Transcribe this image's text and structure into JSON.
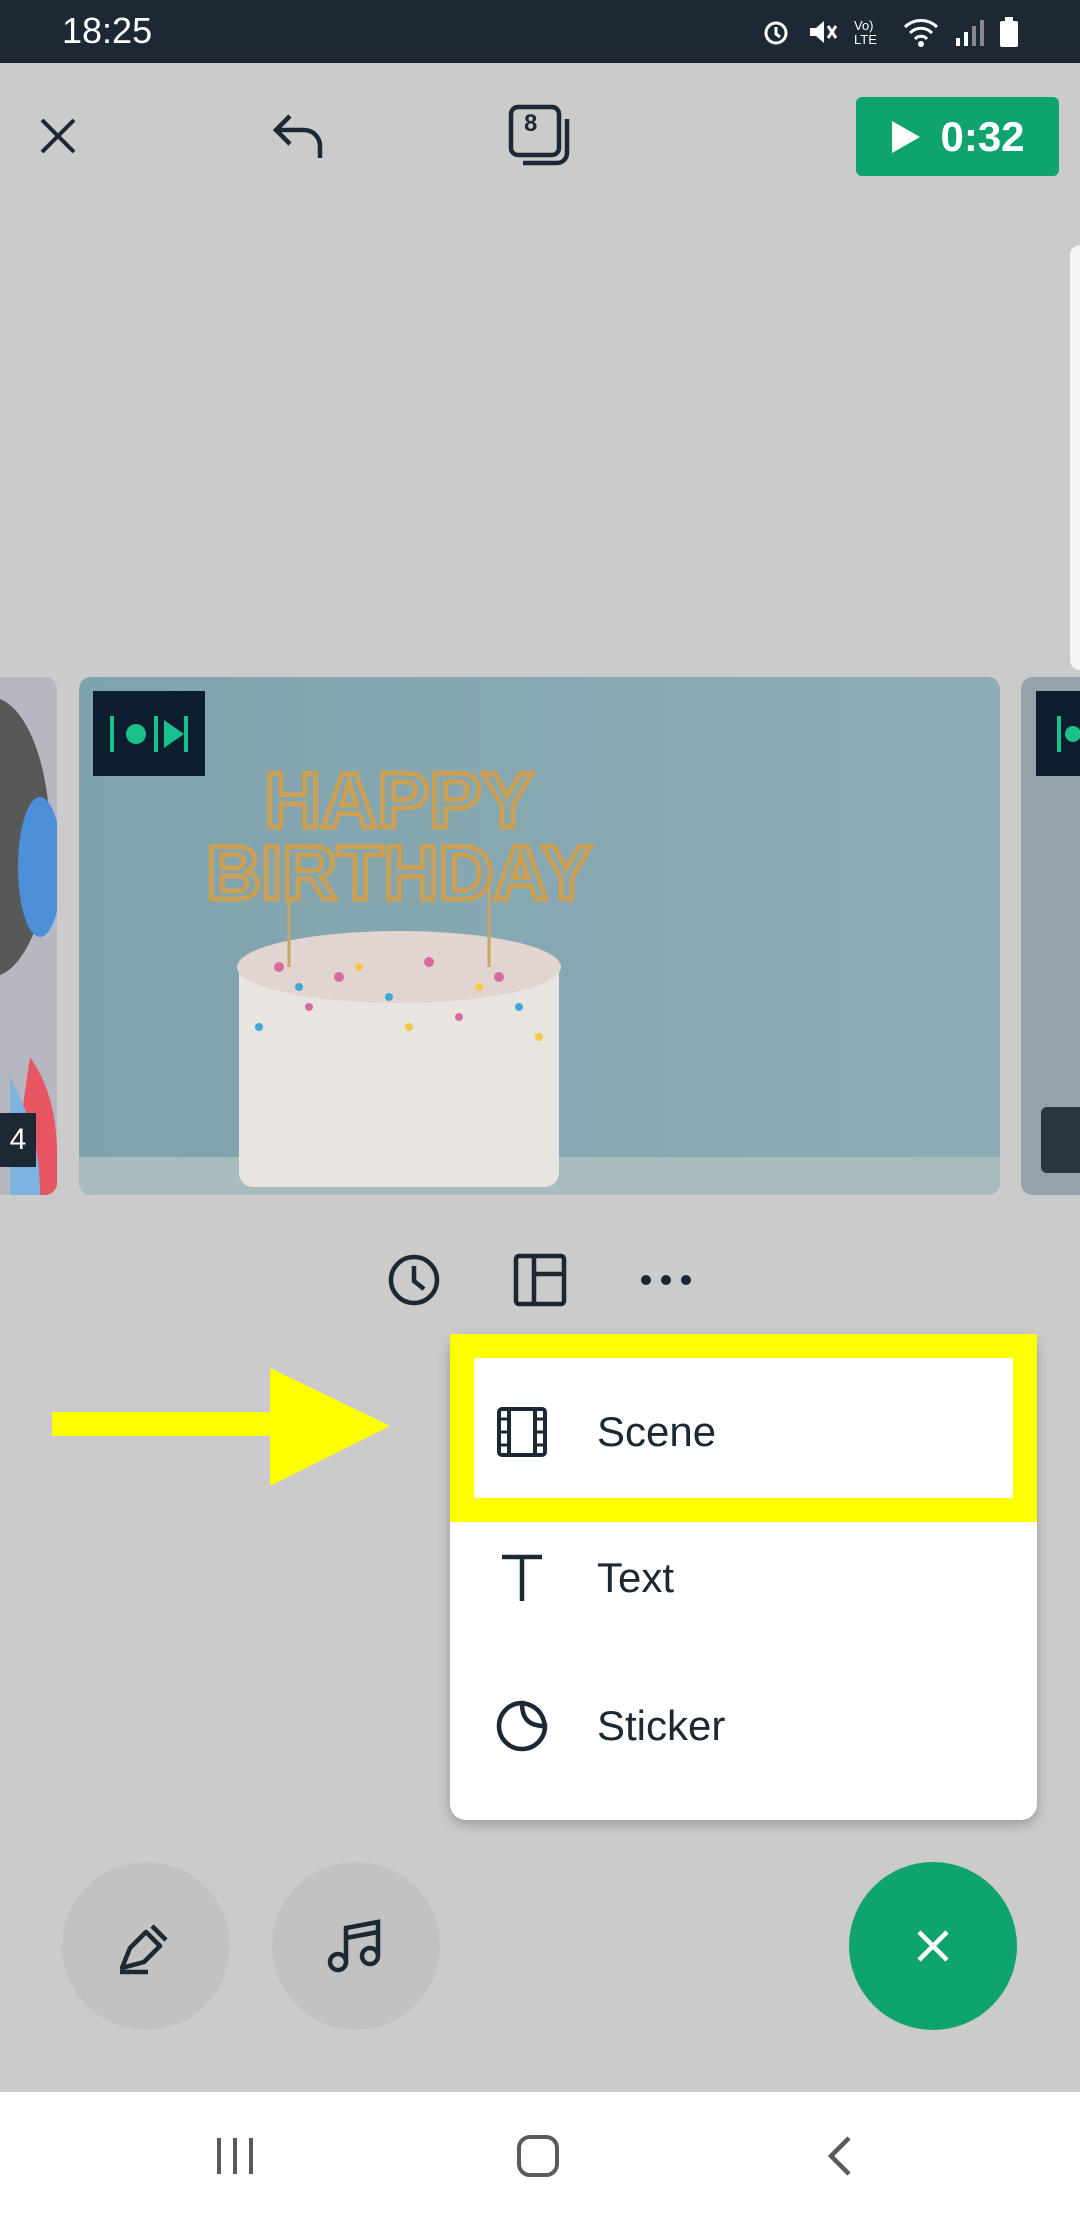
{
  "status": {
    "time": "18:25"
  },
  "toolbar": {
    "close_icon": "close-icon",
    "undo_icon": "undo-icon",
    "scenes_count": "8",
    "play_label": "0:32"
  },
  "scenes": {
    "left_number": "4",
    "center_title": "HAPPY BIRTHDAY"
  },
  "menu": {
    "items": [
      {
        "label": "Scene",
        "icon": "film-icon"
      },
      {
        "label": "Text",
        "icon": "text-icon"
      },
      {
        "label": "Sticker",
        "icon": "sticker-icon"
      }
    ]
  },
  "colors": {
    "accent": "#0fa36e",
    "highlight": "#ffff00",
    "statusbar": "#1c2833"
  }
}
